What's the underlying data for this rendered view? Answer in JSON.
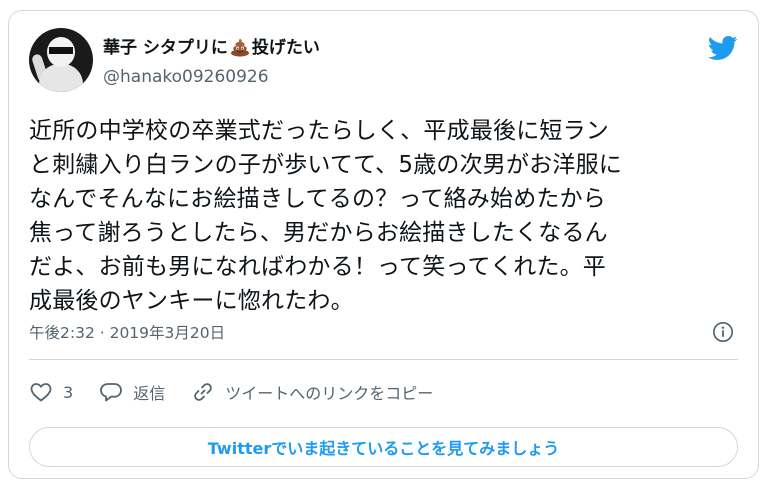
{
  "user": {
    "display_name": "華子 シタプリに",
    "display_name_suffix": "投げたい",
    "emoji": "pile-of-poo",
    "handle": "@hanako09260926"
  },
  "tweet": {
    "text": "近所の中学校の卒業式だったらしく、平成最後に短ラン\nと刺繍入り白ランの子が歩いてて、5歳の次男がお洋服に\nなんでそんなにお絵描きしてるの？って絡み始めたから\n焦って謝ろうとしたら、男だからお絵描きしたくなるん\nだよ、お前も男になればわかる！って笑ってくれた。平\n成最後のヤンキーに惚れたわ。",
    "timestamp": "午後2:32 · 2019年3月20日"
  },
  "actions": {
    "like_count": "3",
    "reply_label": "返信",
    "copy_link_label": "ツイートへのリンクをコピー"
  },
  "cta": {
    "label": "Twitterでいま起きていることを見てみましょう"
  },
  "colors": {
    "accent": "#1d9bf0",
    "secondary_text": "#536471",
    "border": "#cfd9de"
  },
  "icons": [
    "twitter-bird-icon",
    "info-icon",
    "heart-icon",
    "reply-bubble-icon",
    "link-icon",
    "poo-emoji-icon"
  ]
}
